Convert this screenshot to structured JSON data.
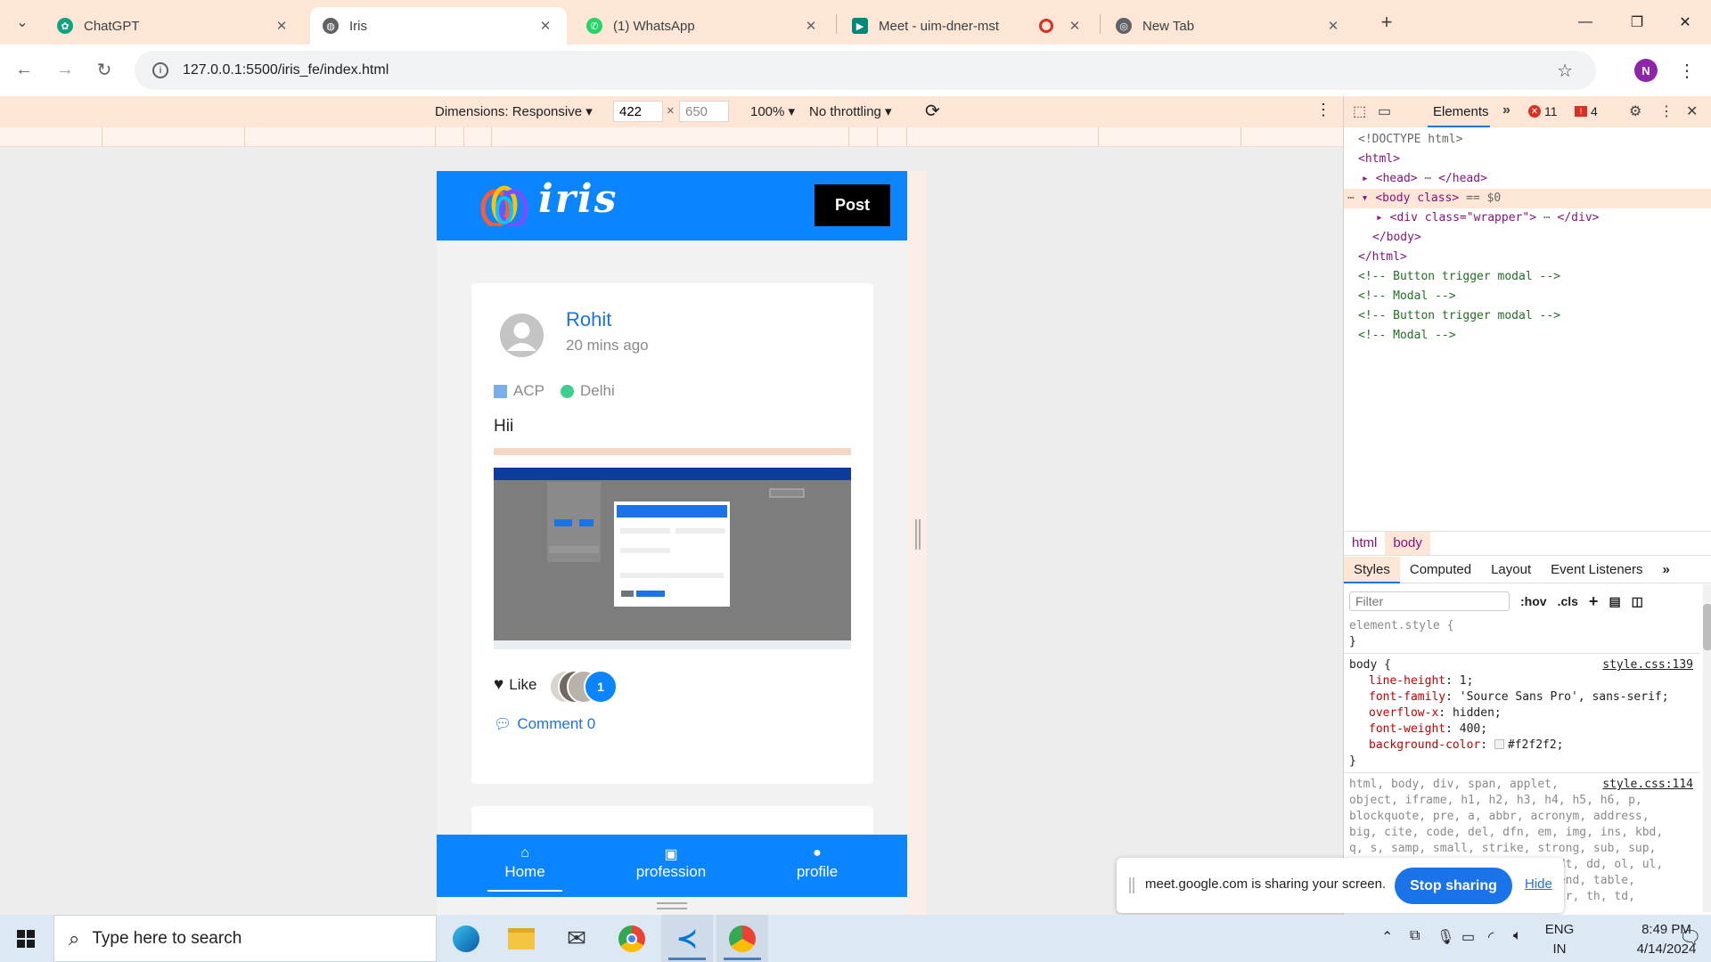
{
  "browser": {
    "tabs": [
      {
        "title": "ChatGPT",
        "icon": "chatgpt-icon",
        "color": "#10a37f"
      },
      {
        "title": "Iris",
        "icon": "globe-icon",
        "color": "#5f6368"
      },
      {
        "title": "(1) WhatsApp",
        "icon": "whatsapp-icon",
        "color": "#25d366"
      },
      {
        "title": "Meet - uim-dner-mst",
        "icon": "meet-icon",
        "color": "#00897b"
      },
      {
        "title": "New Tab",
        "icon": "chrome-icon",
        "color": "#5f6368"
      }
    ],
    "new_tab": "+",
    "url": "127.0.0.1:5500/iris_fe/index.html",
    "profile_initial": "N"
  },
  "device_toolbar": {
    "dimensions_label": "Dimensions: Responsive",
    "width": "422",
    "height": "650",
    "times": "×",
    "zoom": "100%",
    "throttling": "No throttling"
  },
  "app": {
    "brand": "iris",
    "post_button": "Post",
    "post": {
      "author": "Rohit",
      "time": "20 mins ago",
      "profession": "ACP",
      "location": "Delhi",
      "text": "Hii",
      "like_label": "Like",
      "like_count": "1",
      "comment_label": "Comment 0"
    },
    "nav": [
      {
        "label": "Home",
        "icon": "home-icon"
      },
      {
        "label": "profession",
        "icon": "briefcase-icon"
      },
      {
        "label": "profile",
        "icon": "user-icon"
      }
    ]
  },
  "devtools": {
    "elements_tab": "Elements",
    "errors": "11",
    "warnings": "4",
    "dom": {
      "doctype": "<!DOCTYPE html>",
      "html_open": "<html>",
      "head": "<head>",
      "head_close": "</head>",
      "body_open": "<body class>",
      "body_marker": "== $0",
      "div_open": "<div class=\"wrapper\">",
      "div_close": "</div>",
      "body_close": "</body>",
      "html_close": "</html>",
      "comment1": "<!-- Button trigger modal -->",
      "comment2": "<!-- Modal -->",
      "comment3": "<!-- Button trigger modal -->",
      "comment4": "<!-- Modal -->"
    },
    "breadcrumbs": [
      "html",
      "body"
    ],
    "styles_tabs": [
      "Styles",
      "Computed",
      "Layout",
      "Event Listeners"
    ],
    "filter_placeholder": "Filter",
    "hov": ":hov",
    "cls": ".cls",
    "rules": {
      "element_style": "element.style {",
      "close": "}",
      "body_selector": "body {",
      "body_source": "style.css:139",
      "props": [
        {
          "name": "line-height",
          "value": "1;"
        },
        {
          "name": "font-family",
          "value": "'Source Sans Pro', sans-serif;"
        },
        {
          "name": "overflow-x",
          "value": "hidden;"
        },
        {
          "name": "font-weight",
          "value": "400;"
        },
        {
          "name": "background-color",
          "value": "#f2f2f2;"
        }
      ],
      "reset_source": "style.css:114",
      "reset_lines": [
        "html, body, div, span, applet,",
        "object, iframe, h1, h2, h3, h4, h5, h6, p,",
        "blockquote, pre, a, abbr, acronym, address,",
        "big, cite, code, del, dfn, em, img, ins, kbd,",
        "q, s, samp, small, strike, strong, sub, sup,",
        "tt, var, b, u, i, center, dl, dt, dd, ol, ul,",
        "li, fieldset, form, label, legend, table,",
        "caption, tbody, tfoot, thead, tr, th, td,"
      ]
    }
  },
  "share_bar": {
    "message": "meet.google.com is sharing your screen.",
    "stop_button": "Stop sharing",
    "hide_link": "Hide"
  },
  "taskbar": {
    "search_placeholder": "Type here to search",
    "lang_top": "ENG",
    "lang_bottom": "IN",
    "time": "8:49 PM",
    "date": "4/14/2024"
  }
}
